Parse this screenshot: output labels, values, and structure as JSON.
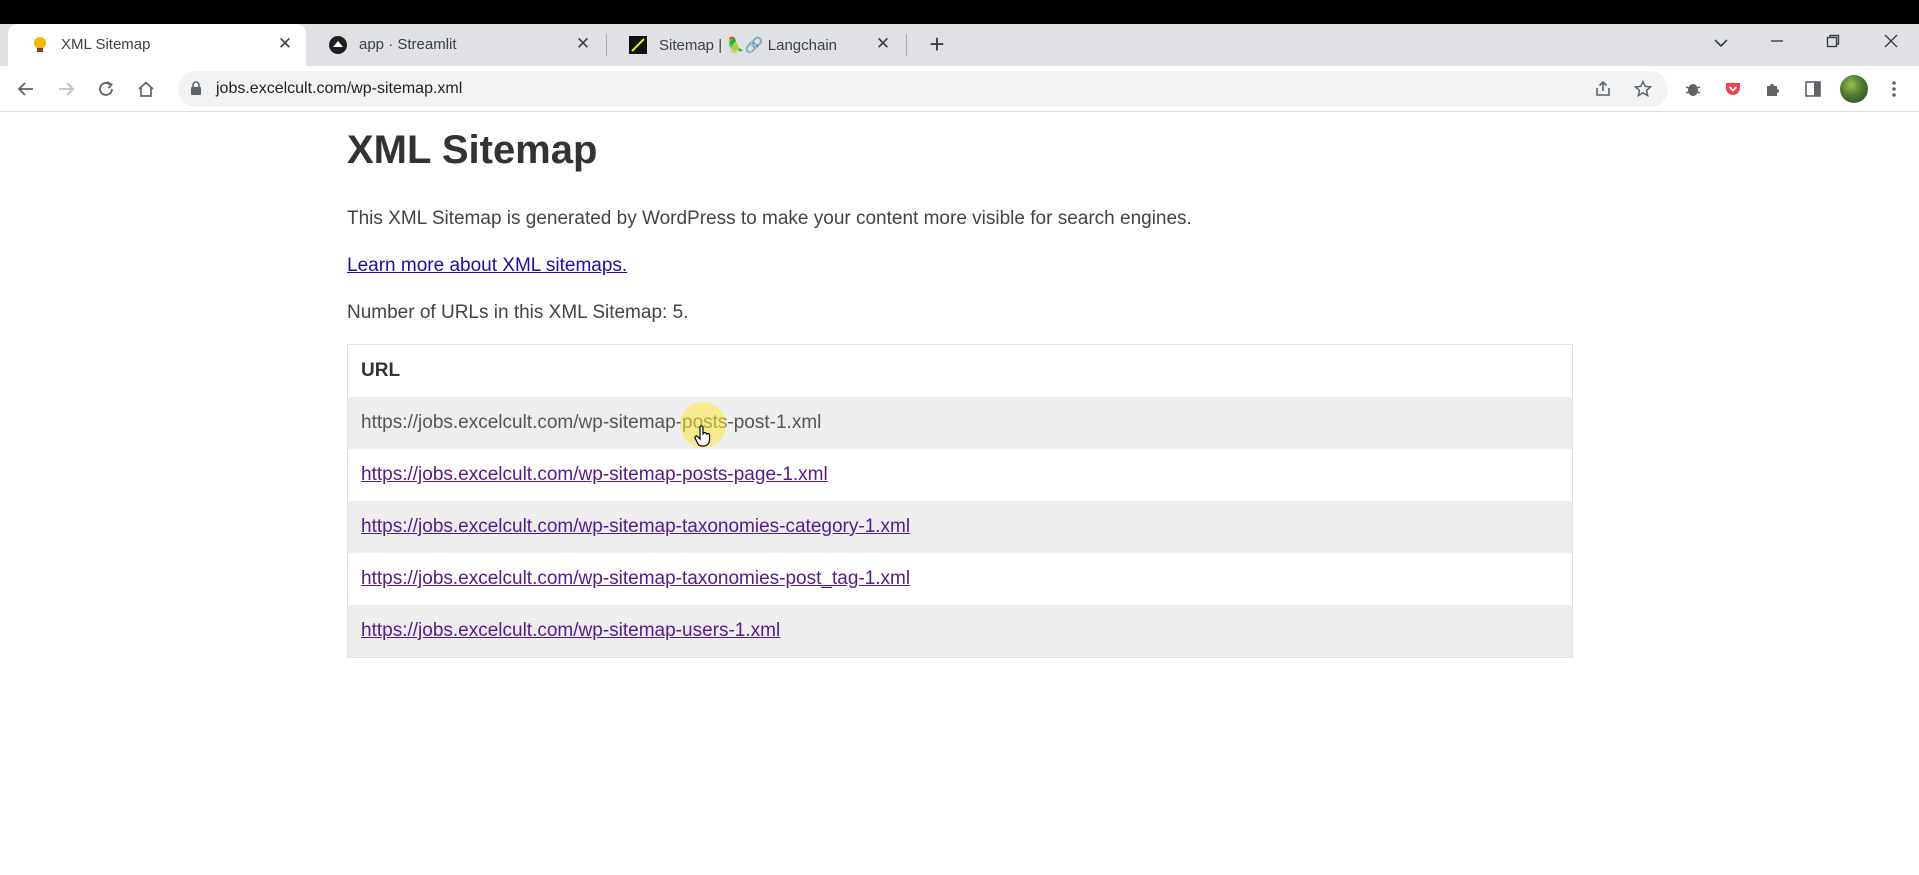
{
  "browser": {
    "tabs": [
      {
        "title": "XML Sitemap",
        "favicon": "bulb-icon",
        "active": true
      },
      {
        "title": "app · Streamlit",
        "favicon": "streamlit-icon",
        "active": false
      },
      {
        "title": "Sitemap | 🦜🔗 Langchain",
        "favicon": "langchain-icon",
        "active": false
      }
    ],
    "tab_close_glyph": "✕",
    "new_tab_glyph": "+",
    "address": "jobs.excelcult.com/wp-sitemap.xml"
  },
  "page": {
    "title": "XML Sitemap",
    "intro": "This XML Sitemap is generated by WordPress to make your content more visible for search engines.",
    "learn_more": "Learn more about XML sitemaps.",
    "count_text": "Number of URLs in this XML Sitemap: 5.",
    "table": {
      "header": "URL",
      "rows": [
        "https://jobs.excelcult.com/wp-sitemap-posts-post-1.xml",
        "https://jobs.excelcult.com/wp-sitemap-posts-page-1.xml",
        "https://jobs.excelcult.com/wp-sitemap-taxonomies-category-1.xml",
        "https://jobs.excelcult.com/wp-sitemap-taxonomies-post_tag-1.xml",
        "https://jobs.excelcult.com/wp-sitemap-users-1.xml"
      ]
    }
  },
  "colors": {
    "link": "#1a0dab",
    "visited_link": "#551a8b",
    "row_shade": "#eeeeee",
    "cursor_halo": "#faeb3c"
  }
}
